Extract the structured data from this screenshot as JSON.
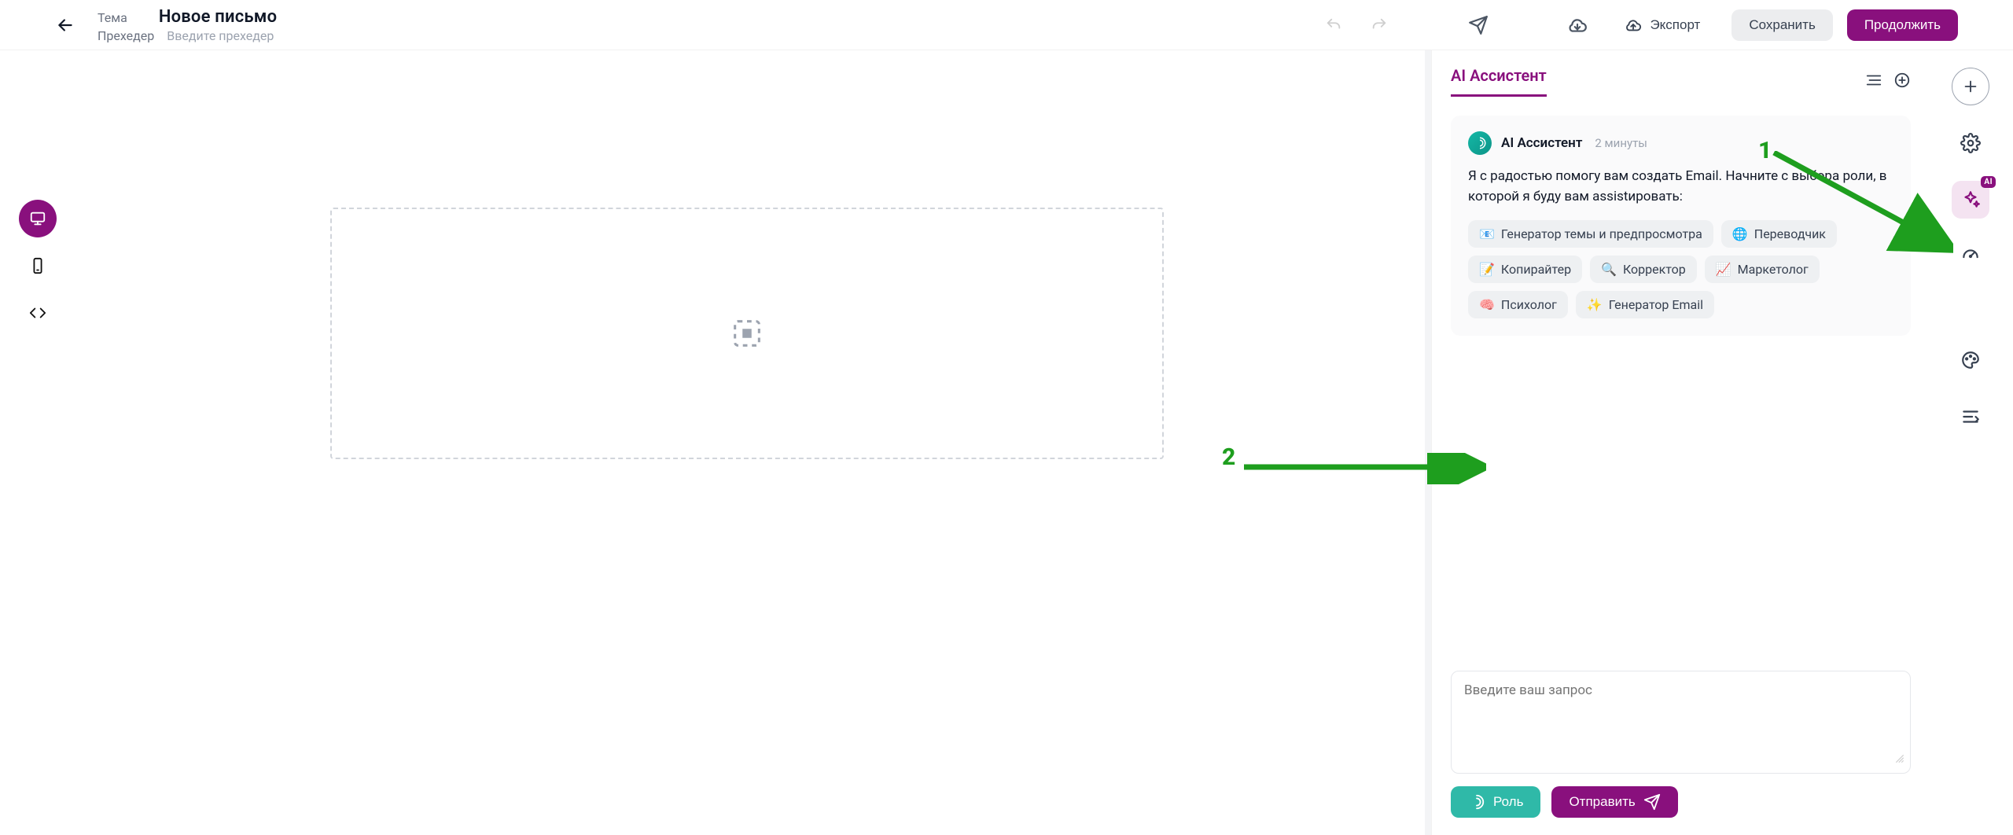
{
  "header": {
    "subject_label": "Тема",
    "subject_value": "Новое письмо",
    "preheader_label": "Прехедер",
    "preheader_placeholder": "Введите прехедер",
    "export_label": "Экспорт",
    "save_label": "Сохранить",
    "continue_label": "Продолжить"
  },
  "editor": {
    "drop_hint": ""
  },
  "assistant": {
    "tab_label": "AI Ассистент",
    "message": {
      "name": "AI Ассистент",
      "time": "2 минуты",
      "body": "Я с радостью помогу вам создать Email. Начните с выбора роли, в которой я буду вам assistировать:"
    },
    "roles": [
      {
        "emoji": "📧",
        "label": "Генератор темы и предпросмотра"
      },
      {
        "emoji": "🌐",
        "label": "Переводчик"
      },
      {
        "emoji": "📝",
        "label": "Копирайтер"
      },
      {
        "emoji": "🔍",
        "label": "Корректор"
      },
      {
        "emoji": "📈",
        "label": "Маркетолог"
      },
      {
        "emoji": "🧠",
        "label": "Психолог"
      },
      {
        "emoji": "✨",
        "label": "Генератор Email"
      }
    ],
    "prompt_placeholder": "Введите ваш запрос",
    "role_button": "Роль",
    "send_button": "Отправить"
  },
  "right_strip": {
    "ai_badge": "AI"
  },
  "annotations": {
    "one": "1",
    "two": "2"
  }
}
